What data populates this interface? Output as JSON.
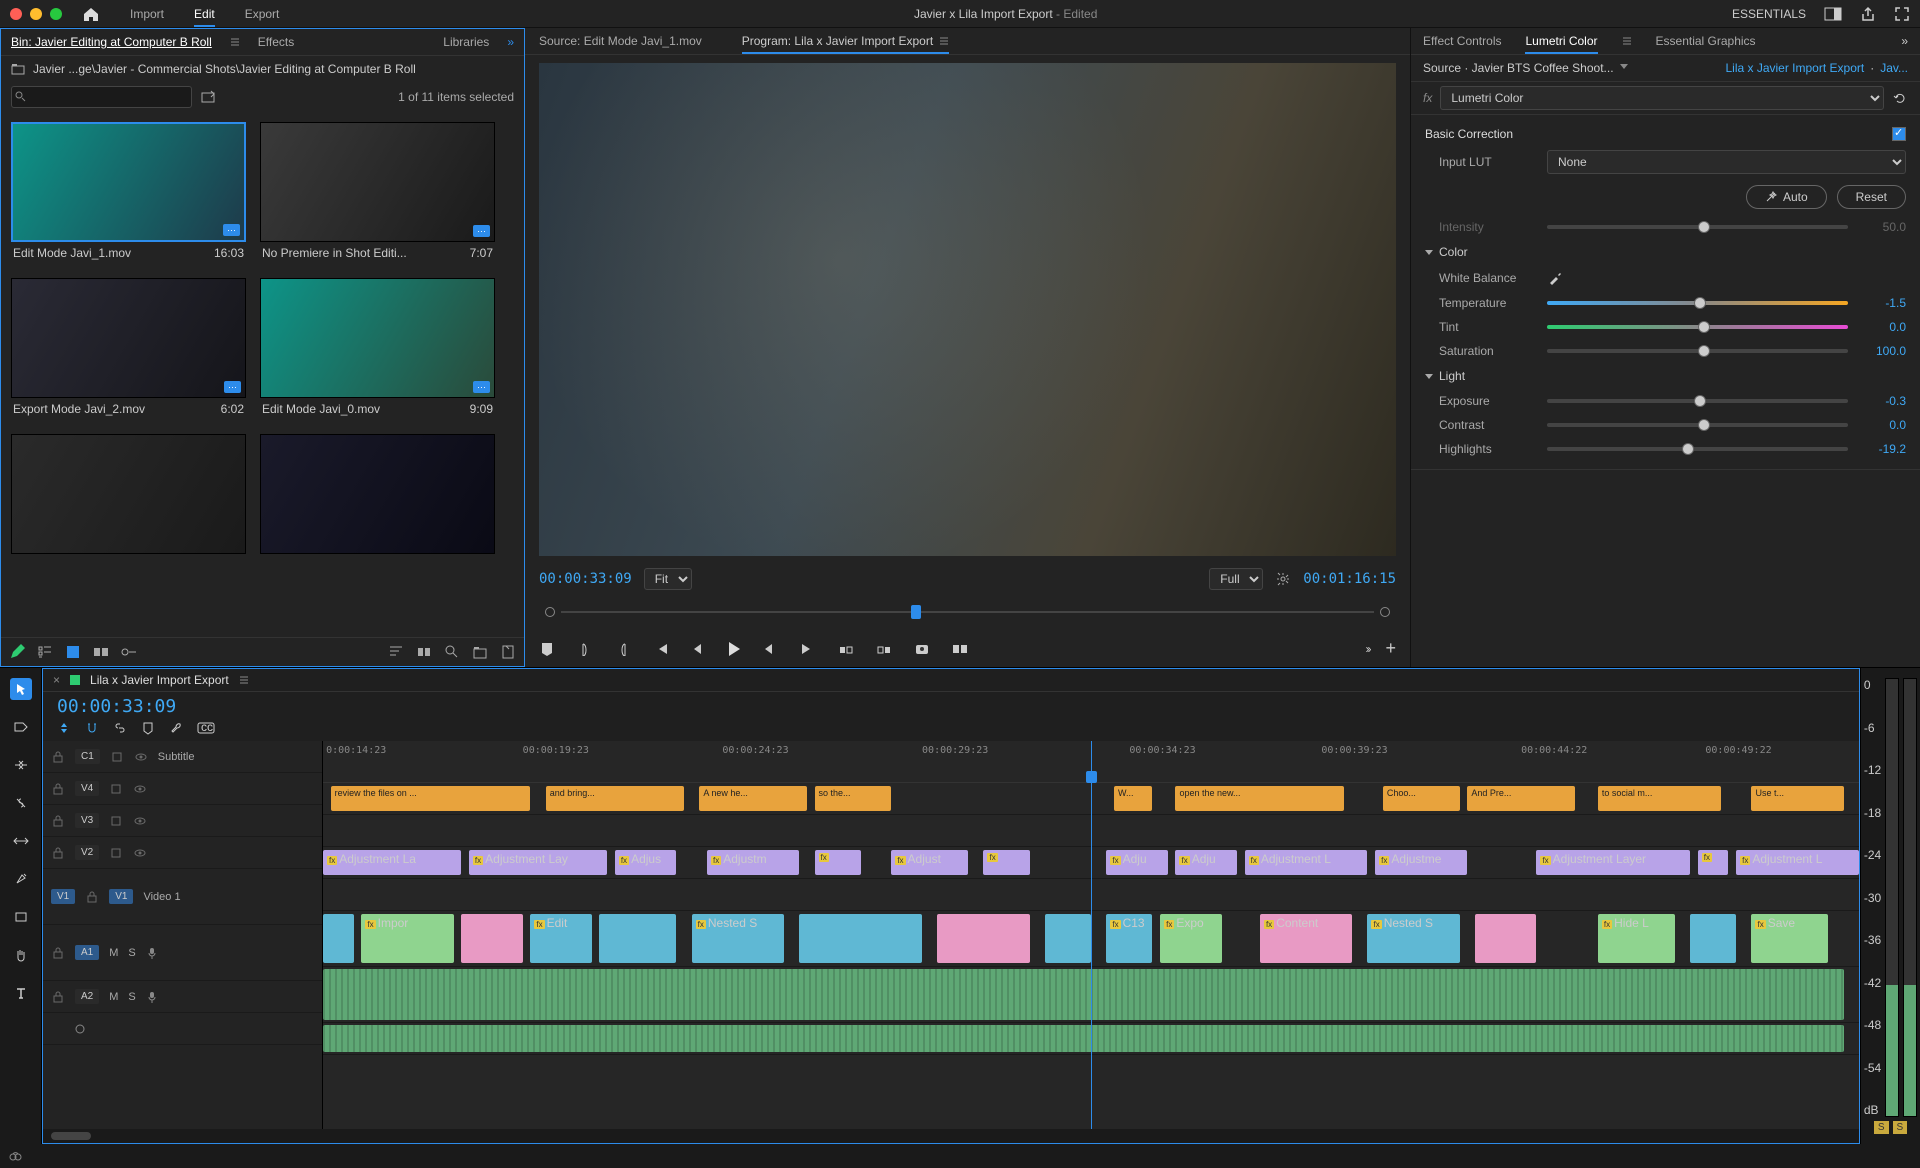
{
  "titlebar": {
    "nav": {
      "import": "Import",
      "edit": "Edit",
      "export": "Export"
    },
    "project": "Javier x Lila Import Export",
    "status": "- Edited",
    "workspace": "ESSENTIALS"
  },
  "project_panel": {
    "tabs": {
      "bin": "Bin: Javier Editing at Computer B Roll",
      "effects": "Effects",
      "libraries": "Libraries"
    },
    "breadcrumb": "Javier ...ge\\Javier - Commercial Shots\\Javier Editing at Computer B Roll",
    "search_placeholder": "",
    "selection": "1 of 11 items selected",
    "clips": [
      {
        "name": "Edit Mode Javi_1.mov",
        "dur": "16:03",
        "sel": true
      },
      {
        "name": "No Premiere in Shot Editi...",
        "dur": "7:07",
        "sel": false
      },
      {
        "name": "Export Mode Javi_2.mov",
        "dur": "6:02",
        "sel": false
      },
      {
        "name": "Edit Mode Javi_0.mov",
        "dur": "9:09",
        "sel": false
      },
      {
        "name": "",
        "dur": "",
        "sel": false
      },
      {
        "name": "",
        "dur": "",
        "sel": false
      }
    ]
  },
  "monitor": {
    "tabs": {
      "source": "Source: Edit Mode Javi_1.mov",
      "program": "Program: Lila x Javier Import Export"
    },
    "in_tc": "00:00:33:09",
    "out_tc": "00:01:16:15",
    "zoom": "Fit",
    "res": "Full"
  },
  "lumetri": {
    "tabs": {
      "ec": "Effect Controls",
      "lc": "Lumetri Color",
      "eg": "Essential Graphics"
    },
    "crumb_source": "Source · Javier BTS Coffee Shoot...",
    "crumb_seq": "Lila x Javier Import Export",
    "crumb_clip": "Jav...",
    "fx_name": "Lumetri Color",
    "section_basic": "Basic Correction",
    "input_lut_label": "Input LUT",
    "input_lut_value": "None",
    "auto_btn": "Auto",
    "reset_btn": "Reset",
    "intensity_label": "Intensity",
    "intensity_val": "50.0",
    "color_label": "Color",
    "wb_label": "White Balance",
    "temp_label": "Temperature",
    "temp_val": "-1.5",
    "tint_label": "Tint",
    "tint_val": "0.0",
    "sat_label": "Saturation",
    "sat_val": "100.0",
    "light_label": "Light",
    "exp_label": "Exposure",
    "exp_val": "-0.3",
    "con_label": "Contrast",
    "con_val": "0.0",
    "hl_label": "Highlights",
    "hl_val": "-19.2"
  },
  "timeline": {
    "seq_name": "Lila x Javier Import Export",
    "playhead_tc": "00:00:33:09",
    "ruler": [
      "0:00:14:23",
      "00:00:19:23",
      "00:00:24:23",
      "00:00:29:23",
      "00:00:34:23",
      "00:00:39:23",
      "00:00:44:22",
      "00:00:49:22"
    ],
    "tracks": {
      "c1": "C1",
      "v4": "V4",
      "v3": "V3",
      "v2": "V2",
      "v1": "V1",
      "a1": "A1",
      "a2": "A2",
      "subtitle": "Subtitle",
      "video1": "Video 1",
      "m": "M",
      "s": "S"
    },
    "captions": [
      "review the files on ...",
      "and bring...",
      "A new he...",
      "so the...",
      "W...",
      "open the new...",
      "Choo...",
      "And Pre...",
      "to social m...",
      "Use t..."
    ],
    "adj": [
      "Adjustment La",
      "Adjustment Lay",
      "Adjus",
      "Adjustm",
      "Adjust",
      "Adju",
      "Adju",
      "Adjustment L",
      "Adjustme",
      "Adjustment Layer",
      "Adjustment L"
    ],
    "v1": [
      "Impor",
      "Edit",
      "Nested S",
      "C13",
      "Expo",
      "Content",
      "Nested S",
      "Hide L",
      "Save"
    ]
  },
  "meters": {
    "scale": [
      "0",
      "-6",
      "-12",
      "-18",
      "-24",
      "-30",
      "-36",
      "-42",
      "-48",
      "-54",
      "dB"
    ],
    "solo": "S"
  }
}
